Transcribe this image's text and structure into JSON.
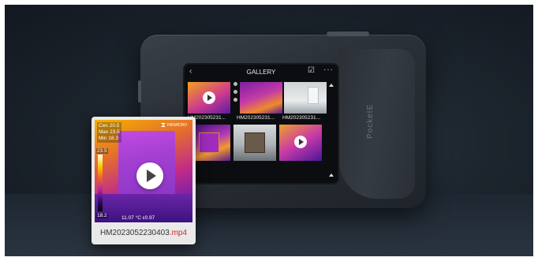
{
  "screen": {
    "back_icon": "chevron-left-icon",
    "title": "GALLERY",
    "select_icon": "checkbox-select-icon",
    "more_icon": "more-dots-icon",
    "items": [
      {
        "caption": "HM202305231..."
      },
      {
        "caption": "HM202305231..."
      },
      {
        "caption": "HM202305231..."
      },
      {
        "caption": ""
      },
      {
        "caption": ""
      },
      {
        "caption": ""
      }
    ]
  },
  "camera": {
    "brand": "PocketE"
  },
  "card": {
    "cen": "Cen  20.5",
    "max": "Max  23.5",
    "min": "Min  18.3",
    "scale_top": "23.5",
    "scale_bottom": "18.2",
    "footer": "11.07   °C   ε0.97",
    "brand_mark": "HIKMICRO",
    "filename_base": "HM2023052230403",
    "filename_ext": ".mp4"
  },
  "colors": {
    "accent_ext": "#d42a2a",
    "background": "#1d252e"
  }
}
